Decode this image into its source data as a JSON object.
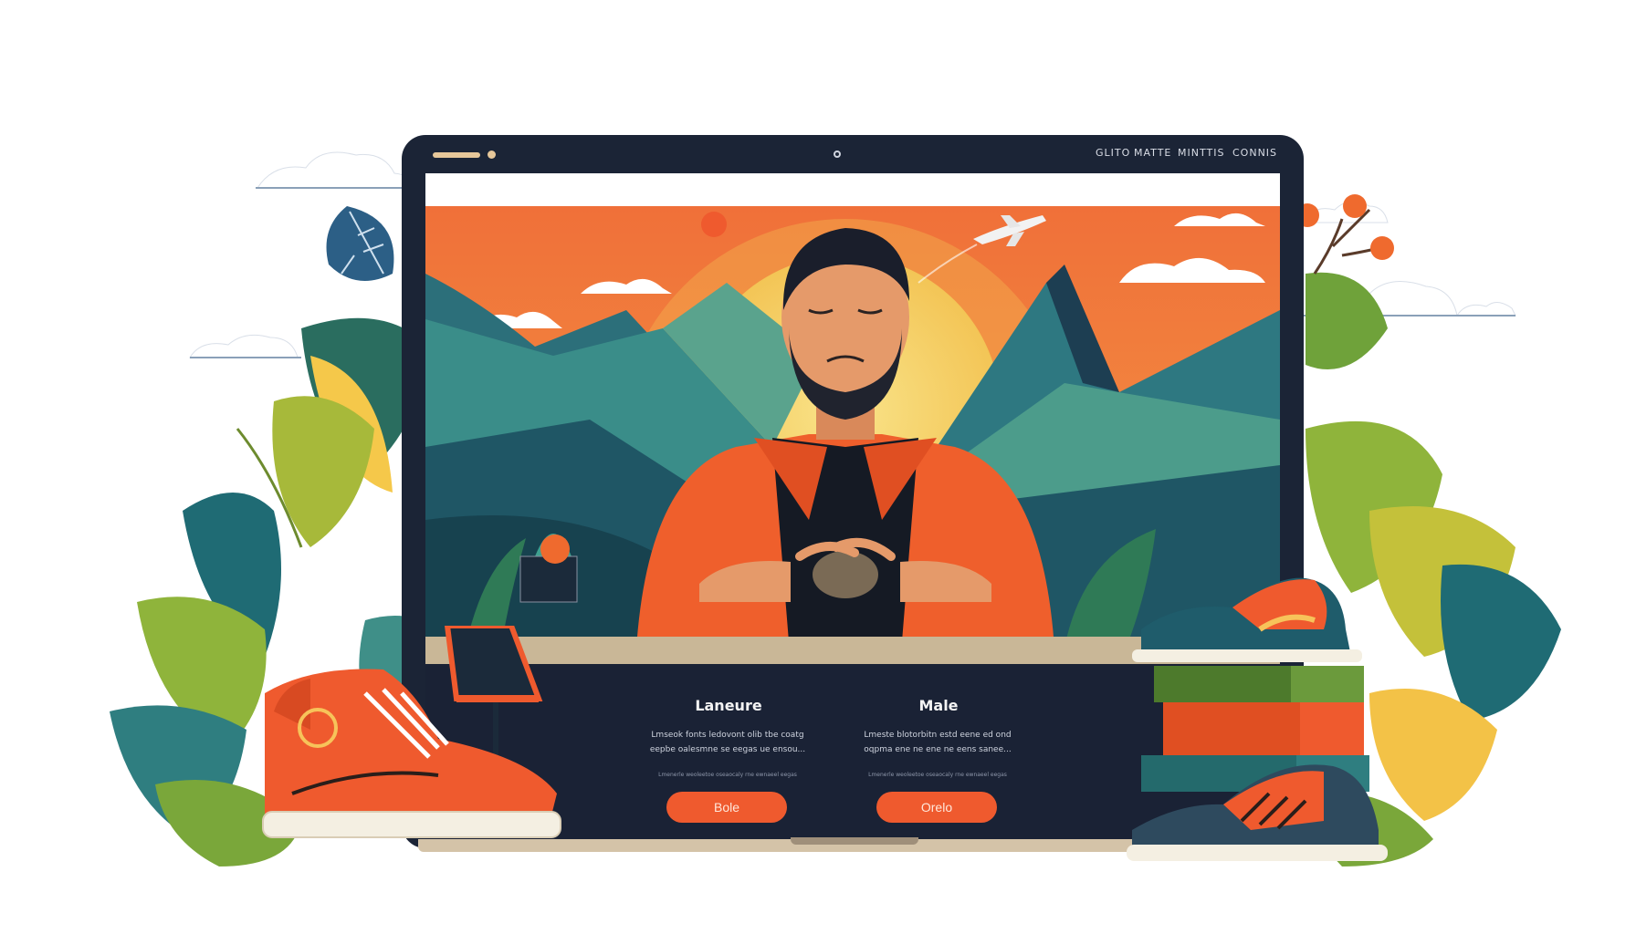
{
  "window": {
    "nav_links": [
      "GLITO",
      "MATTE",
      "MINTTIS",
      "CONNIS"
    ]
  },
  "panel": {
    "columns": [
      {
        "title": "Laneure",
        "text": [
          "Lmseok fonts ledovont olib tbe coatg",
          "eepbe oalesmne se eegas ue ensou..."
        ],
        "small": "Lmenerle weoleetoe oseaocaly rne ewnaeel eegas",
        "button_label": "Bole"
      },
      {
        "title": "Male",
        "text": [
          "Lmeste blotorbitn estd eene ed ond",
          "oqpma ene ne ene ne eens sanee..."
        ],
        "small": "Lmenerle weoleetoe oseaocaly rne ewnaeel eegas",
        "button_label": "Orelo"
      }
    ]
  },
  "colors": {
    "accent": "#ef5a2e",
    "frame": "#1b2436",
    "panel": "#1a2235",
    "sky_orange": "#f07a3a",
    "sun": "#f7d46a",
    "mountain_teal": "#2f7e80",
    "leaf_green": "#7fae3a"
  },
  "icons": [
    "airplane-icon",
    "camera-icon",
    "window-dot-icon"
  ]
}
